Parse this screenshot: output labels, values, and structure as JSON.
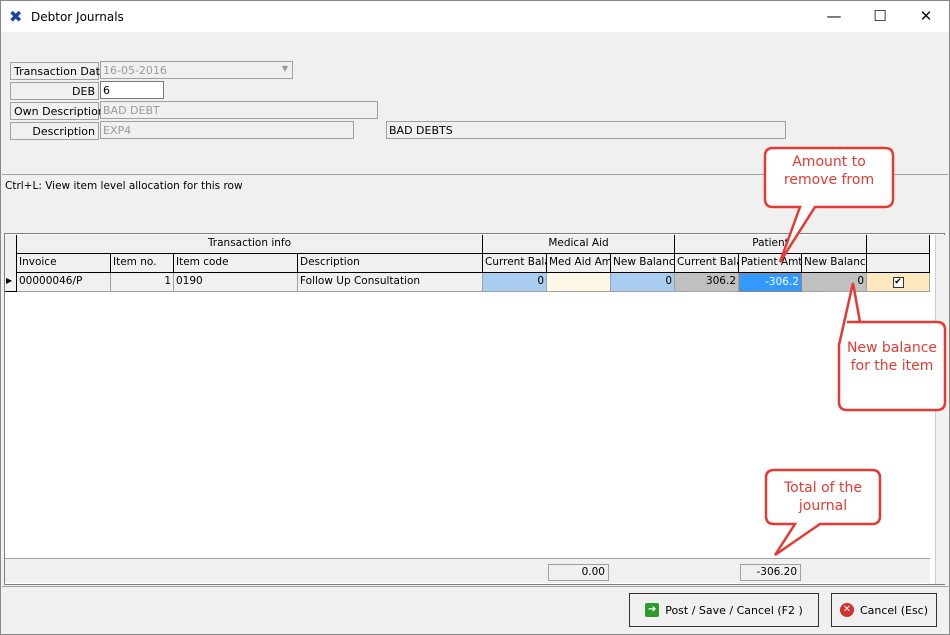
{
  "window": {
    "title": "Debtor Journals",
    "app_icon": "tools-icon",
    "minimize": "—",
    "maximize": "☐",
    "close": "✕"
  },
  "form": {
    "transaction_date": {
      "label": "Transaction Date",
      "value": "16-05-2016"
    },
    "deb": {
      "label": "DEB",
      "value": "6"
    },
    "own_description": {
      "label": "Own Description",
      "value": "BAD DEBT"
    },
    "description": {
      "label": "Description",
      "value": "EXP4",
      "lookup": "BAD DEBTS"
    }
  },
  "hint": "Ctrl+L: View item level allocation for this row",
  "grid": {
    "groups": [
      "Transaction info",
      "Medical Aid",
      "Patient",
      ""
    ],
    "columns": [
      "Invoice",
      "Item no.",
      "Item code",
      "Description",
      "Current Bala",
      "Med Aid Amt",
      "New Balanc",
      "Current Bala",
      "Patient Amt",
      "New Balanc",
      ""
    ],
    "rows": [
      {
        "invoice": "00000046/P",
        "item_no": "1",
        "item_code": "0190",
        "description": "Follow Up Consultation",
        "ma_current": "0",
        "ma_amt": "",
        "ma_new": "0",
        "pt_current": "306.2",
        "pt_amt": "-306.2",
        "pt_new": "0",
        "selected": true
      }
    ],
    "totals": {
      "med_aid": "0.00",
      "patient": "-306.20"
    }
  },
  "buttons": {
    "post": "Post / Save / Cancel  (F2 )",
    "cancel": "Cancel (Esc)"
  },
  "callouts": {
    "amount": "Amount to remove from",
    "new_balance": "New balance for the item",
    "total": "Total of the journal"
  },
  "colors": {
    "accent_blue": "#3399ff",
    "light_blue": "#a8cdf0",
    "cream": "#fdf7e7",
    "check_cell": "#fde8c0",
    "grey_cell": "#c0c0c0",
    "callout_red": "#e53a33"
  }
}
